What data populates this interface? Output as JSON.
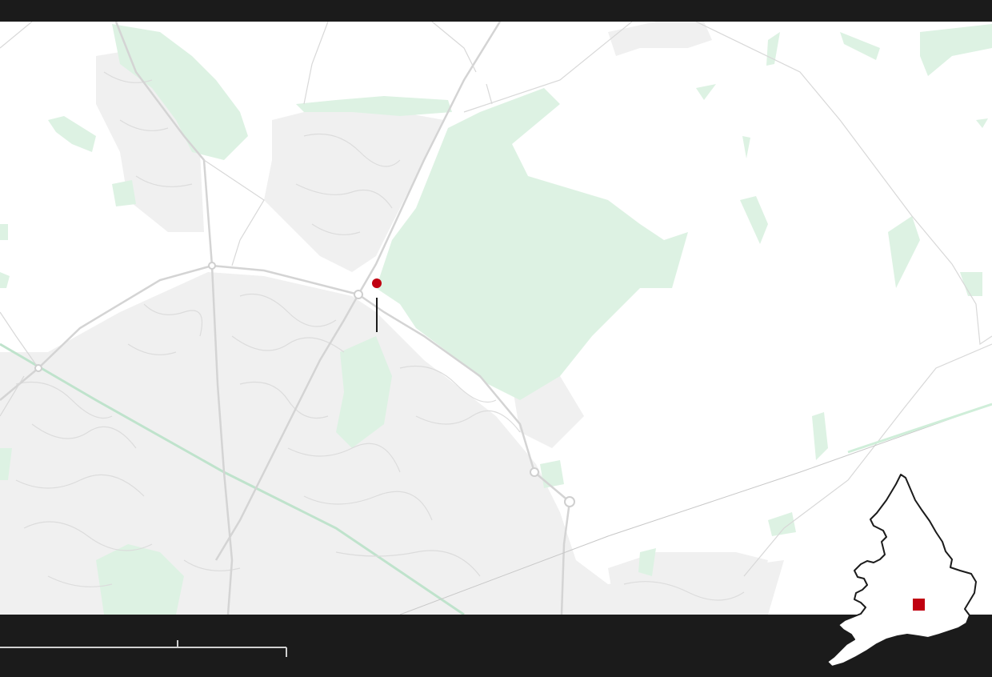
{
  "map": {
    "marker_color": "#c00010",
    "land_color": "#ffffff",
    "urban_color": "#f0f0f0",
    "green_color": "#ddf2e3",
    "road_color": "#d4d4d4",
    "background_color": "#1b1b1b",
    "labels": []
  },
  "scale": {
    "label_left": "",
    "label_right": ""
  },
  "inset": {
    "region_name": "",
    "highlight_color": "#c00010",
    "outline_color": "#1b1b1b"
  }
}
